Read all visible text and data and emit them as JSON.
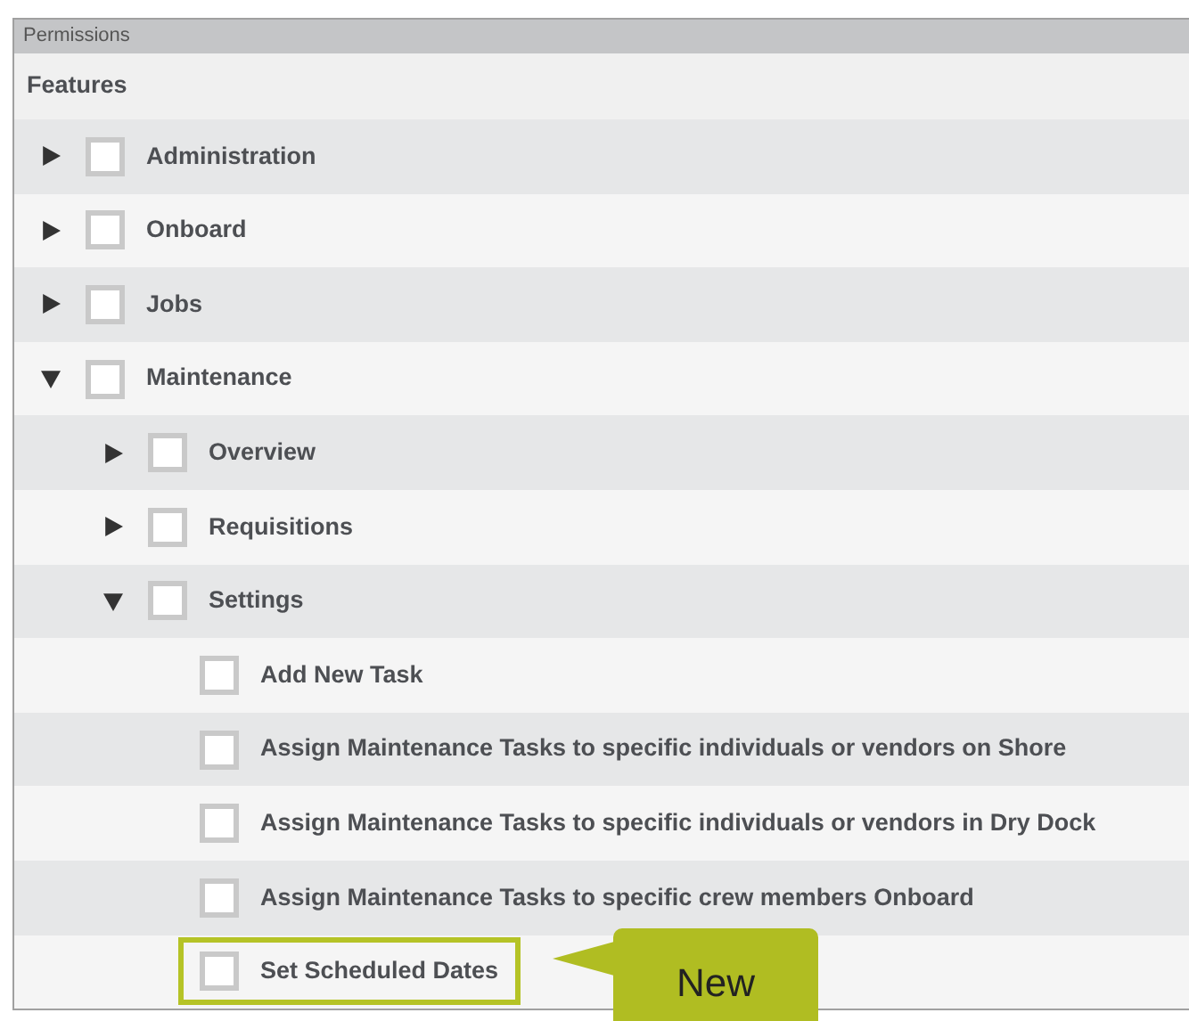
{
  "panel": {
    "title": "Permissions",
    "heading": "Features"
  },
  "features": [
    {
      "label": "Administration",
      "checked": false,
      "expanded": false,
      "highlighted": false
    },
    {
      "label": "Onboard",
      "checked": false,
      "expanded": false,
      "highlighted": false
    },
    {
      "label": "Jobs",
      "checked": false,
      "expanded": false,
      "highlighted": false
    },
    {
      "label": "Maintenance",
      "checked": false,
      "expanded": true,
      "highlighted": false,
      "children": [
        {
          "label": "Overview",
          "checked": false,
          "expanded": false,
          "highlighted": false
        },
        {
          "label": "Requisitions",
          "checked": false,
          "expanded": false,
          "highlighted": false
        },
        {
          "label": "Settings",
          "checked": false,
          "expanded": true,
          "highlighted": false,
          "children": [
            {
              "label": "Add New Task",
              "checked": false,
              "highlighted": false
            },
            {
              "label": "Assign Maintenance Tasks to specific individuals or vendors on Shore",
              "checked": false,
              "highlighted": false
            },
            {
              "label": "Assign Maintenance Tasks to specific individuals or vendors in Dry Dock",
              "checked": false,
              "highlighted": false
            },
            {
              "label": "Assign Maintenance Tasks to specific crew members Onboard",
              "checked": false,
              "highlighted": false
            },
            {
              "label": "Set Scheduled Dates",
              "checked": false,
              "highlighted": true
            }
          ]
        }
      ]
    }
  ],
  "callout": {
    "text": "New"
  }
}
